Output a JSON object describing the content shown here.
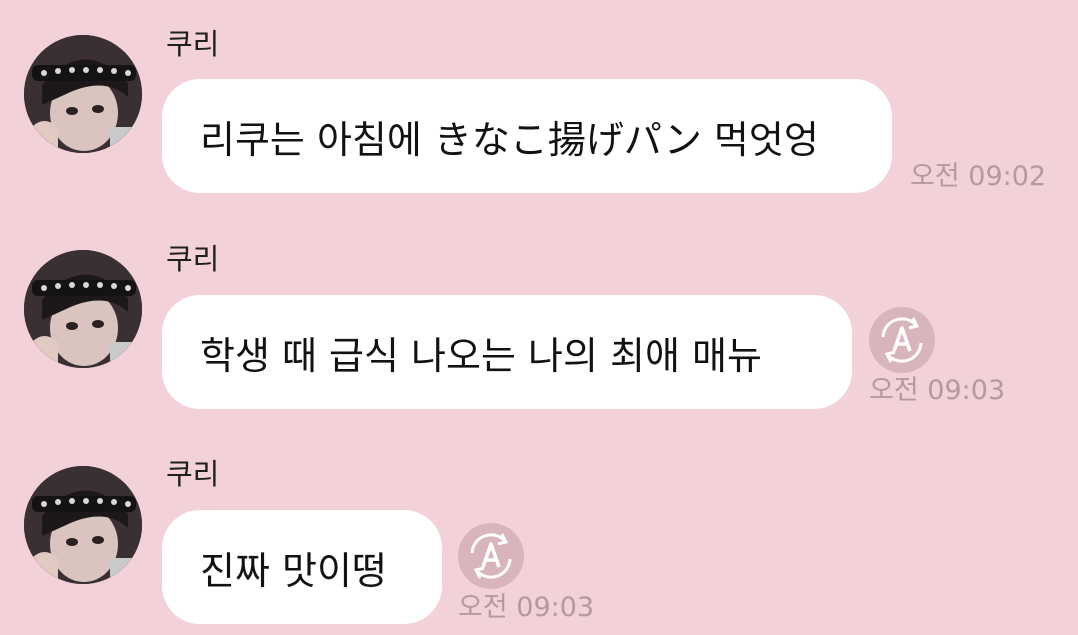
{
  "messages": [
    {
      "sender": "쿠리",
      "text": "리쿠는 아침에 きなこ揚げパン 먹엇엉",
      "time": "오전 09:02",
      "translate_icon": false
    },
    {
      "sender": "쿠리",
      "text": "학생 때 급식 나오는 나의 최애 매뉴",
      "time": "오전 09:03",
      "translate_icon": true
    },
    {
      "sender": "쿠리",
      "text": "진짜 맛이떵",
      "time": "오전 09:03",
      "translate_icon": true
    }
  ],
  "icons": {
    "translate": "translate-icon"
  },
  "colors": {
    "background": "#f2d1d9",
    "bubble": "#ffffff",
    "timestamp": "#b39aa0",
    "icon": "#d8b4bd"
  }
}
